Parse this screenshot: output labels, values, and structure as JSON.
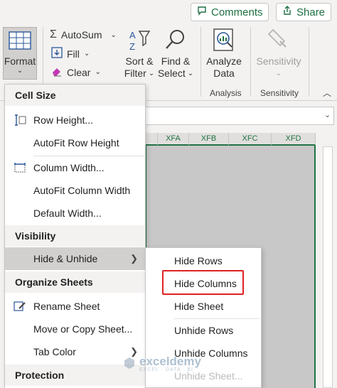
{
  "top_buttons": {
    "comments": "Comments",
    "share": "Share"
  },
  "ribbon": {
    "format_label": "Format",
    "autosum_label": "AutoSum",
    "fill_label": "Fill",
    "clear_label": "Clear",
    "sort_filter_line1": "Sort &",
    "sort_filter_line2": "Filter",
    "find_select_line1": "Find &",
    "find_select_line2": "Select",
    "analyze_line1": "Analyze",
    "analyze_line2": "Data",
    "sensitivity_label": "Sensitivity",
    "group_analysis": "Analysis",
    "group_sensitivity": "Sensitivity"
  },
  "columns": [
    "XFA",
    "XFB",
    "XFC",
    "XFD"
  ],
  "menu": {
    "cell_size_header": "Cell Size",
    "row_height": "Row Height...",
    "autofit_row_height": "AutoFit Row Height",
    "column_width": "Column Width...",
    "autofit_column_width": "AutoFit Column Width",
    "default_width": "Default Width...",
    "visibility_header": "Visibility",
    "hide_unhide": "Hide & Unhide",
    "organize_header": "Organize Sheets",
    "rename_sheet": "Rename Sheet",
    "move_copy_sheet": "Move or Copy Sheet...",
    "tab_color": "Tab Color",
    "protection_header": "Protection"
  },
  "submenu": {
    "hide_rows": "Hide Rows",
    "hide_columns": "Hide Columns",
    "hide_sheet": "Hide Sheet",
    "unhide_rows": "Unhide Rows",
    "unhide_columns": "Unhide Columns",
    "unhide_sheet": "Unhide Sheet..."
  },
  "watermark": {
    "name": "exceldemy",
    "tagline": "EXCEL · DATA · BI"
  },
  "colors": {
    "accent": "#217346",
    "highlight_box": "#e02020"
  }
}
